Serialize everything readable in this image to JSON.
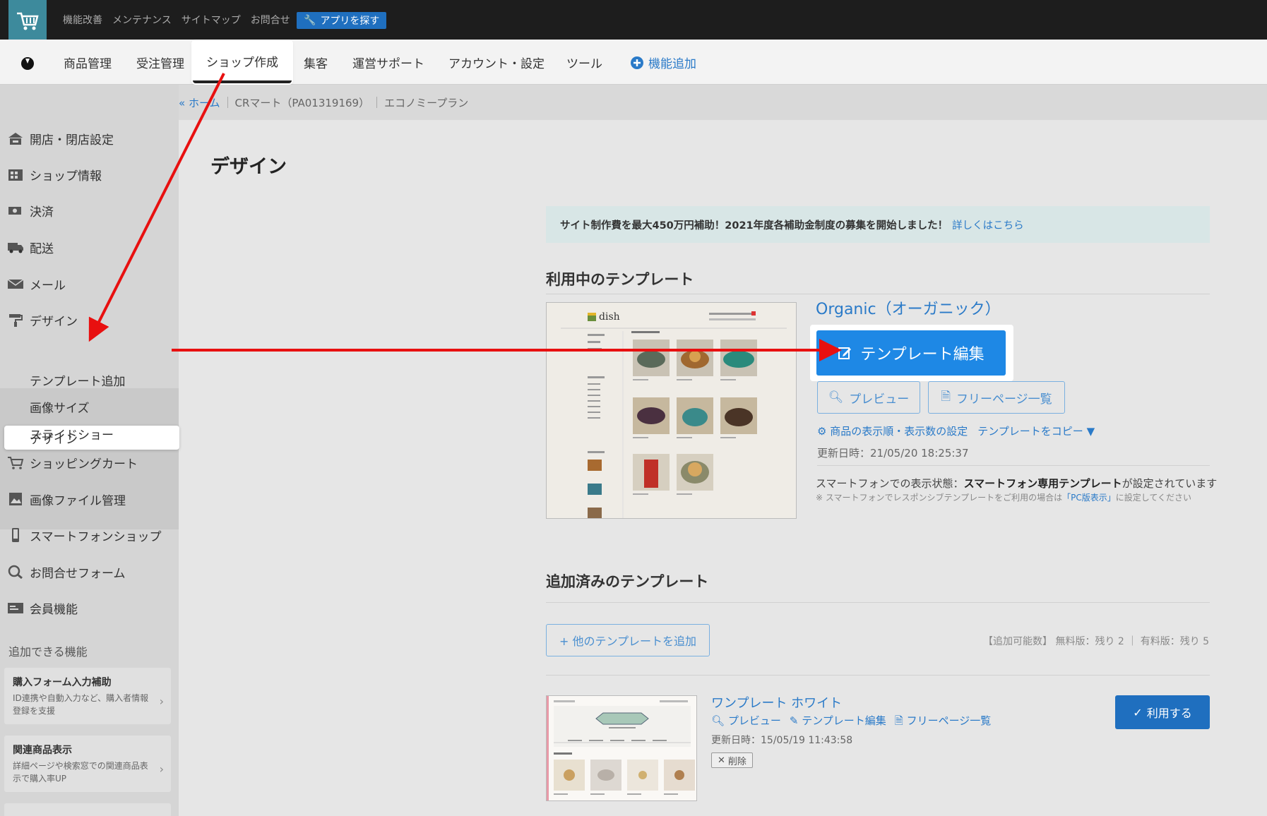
{
  "topbar": {
    "links": [
      "機能改善",
      "メンテナンス",
      "サイトマップ",
      "お問合せ"
    ],
    "app_button": "アプリを探す"
  },
  "mainnav": {
    "items": [
      "商品管理",
      "受注管理",
      "ショップ作成",
      "集客",
      "運営サポート",
      "アカウント・設定",
      "ツール"
    ],
    "add_feature": "機能追加"
  },
  "breadcrumb": {
    "home": "« ホーム",
    "shop": "CRマート（PA01319169）",
    "plan": "エコノミープラン"
  },
  "sidebar": {
    "items": [
      "開店・閉店設定",
      "ショップ情報",
      "決済",
      "配送",
      "メール",
      "デザイン",
      "ショッピングカート",
      "画像ファイル管理",
      "スマートフォンショップ",
      "お問合せフォーム",
      "会員機能"
    ],
    "design_sub": [
      "デザイン",
      "テンプレート追加",
      "画像サイズ",
      "スライドショー"
    ],
    "addable_heading": "追加できる機能",
    "features": [
      {
        "title": "購入フォーム入力補助",
        "desc": "ID連携や自動入力など、購入者情報登録を支援"
      },
      {
        "title": "関連商品表示",
        "desc": "詳細ページや検索窓での関連商品表示で購入率UP"
      }
    ]
  },
  "main": {
    "title": "デザイン",
    "notice": {
      "text": "サイト制作費を最大450万円補助！2021年度各補助金制度の募集を開始しました！",
      "link": "詳しくはこちら"
    },
    "current_heading": "利用中のテンプレート",
    "current": {
      "thumb_brand": "dish",
      "name": "Organic（オーガニック）",
      "edit_label": "テンプレート編集",
      "preview_label": "プレビュー",
      "free_pages_label": "フリーページ一覧",
      "order_setting_link": "商品の表示順・表示数の設定",
      "copy_link": "テンプレートをコピー ▼",
      "updated": "更新日時：21/05/20 18:25:37",
      "sp_status_prefix": "スマートフォンでの表示状態：",
      "sp_status_bold": "スマートフォン専用テンプレート",
      "sp_status_suffix": "が設定されています",
      "sp_note_prefix": "※ スマートフォンでレスポンシブテンプレートをご利用の場合は",
      "sp_note_link": "「PC版表示」",
      "sp_note_suffix": "に設定してください"
    },
    "added_heading": "追加済みのテンプレート",
    "add_button": "+ 他のテンプレートを追加",
    "remaining": "【追加可能数】 無料版：残り 2 ｜ 有料版：残り 5",
    "added": [
      {
        "name": "ワンプレート ホワイト",
        "preview": "プレビュー",
        "edit": "テンプレート編集",
        "free_pages": "フリーページ一覧",
        "updated": "更新日時：15/05/19 11:43:58",
        "delete": "削除",
        "use": "利用する"
      }
    ]
  },
  "colors": {
    "accent": "#1e88e5",
    "link": "#2a7ac8",
    "annotation_arrow": "#e81010"
  }
}
